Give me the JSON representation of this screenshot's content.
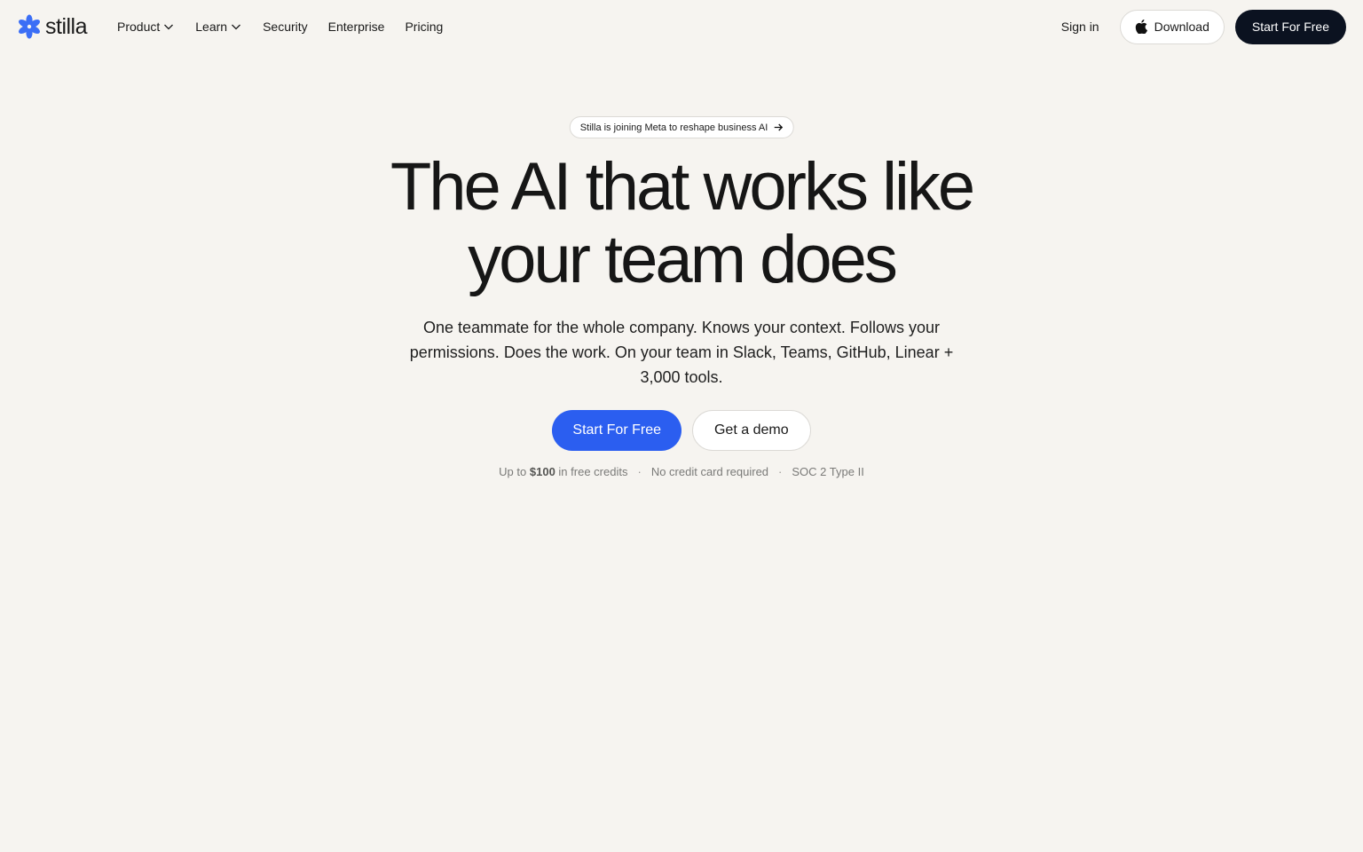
{
  "brand": {
    "name": "stilla",
    "accent_color": "#3b6ef6",
    "logo_icon": "asterisk-flower-icon"
  },
  "nav": {
    "links": [
      {
        "label": "Product",
        "has_dropdown": true
      },
      {
        "label": "Learn",
        "has_dropdown": true
      },
      {
        "label": "Security",
        "has_dropdown": false
      },
      {
        "label": "Enterprise",
        "has_dropdown": false
      },
      {
        "label": "Pricing",
        "has_dropdown": false
      }
    ],
    "sign_in": "Sign in",
    "download": {
      "label": "Download",
      "icon": "apple-icon"
    },
    "start_free": "Start For Free"
  },
  "hero": {
    "announcement": "Stilla is joining Meta to reshape business AI",
    "title_line_1": "The AI that works like",
    "title_line_2": "your team does",
    "subtitle": "One teammate for the whole company. Knows your context. Follows your permissions. Does the work. On your team in Slack, Teams, GitHub, Linear + 3,000 tools.",
    "cta_primary": "Start For Free",
    "cta_secondary": "Get a demo",
    "primary_color": "#2b5ef0",
    "trust": {
      "credits_prefix": "Up to",
      "credits_amount": "$100",
      "credits_suffix": "in free credits",
      "separator": "·",
      "no_card": "No credit card required",
      "compliance": "SOC 2 Type II"
    }
  }
}
